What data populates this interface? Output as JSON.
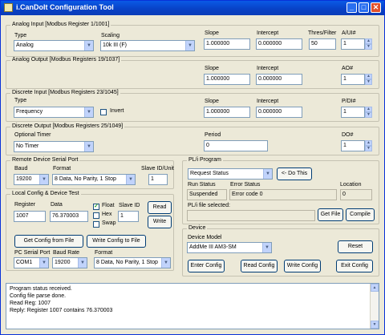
{
  "window": {
    "title": "i.CanDoIt Configuration Tool",
    "minimize": "_",
    "maximize": "□",
    "close": "✕"
  },
  "analog_input": {
    "legend": "Analog Input    [Modbus Register 1/1001]",
    "type_label": "Type",
    "type_value": "Analog",
    "scaling_label": "Scaling",
    "scaling_value": "10k III (F)",
    "slope_label": "Slope",
    "slope_value": "1.000000",
    "intercept_label": "Intercept",
    "intercept_value": "0.000000",
    "thres_label": "Thres/Filter",
    "thres_value": "50",
    "ui_label": "A/UI#",
    "ui_value": "1"
  },
  "analog_output": {
    "legend": "Analog Output    [Modbus Registers 19/1037]",
    "slope_label": "Slope",
    "slope_value": "1.000000",
    "intercept_label": "Intercept",
    "intercept_value": "0.000000",
    "ao_label": "AO#",
    "ao_value": "1"
  },
  "discrete_input": {
    "legend": "Discrete Input    [Modbus Registers 23/1045]",
    "type_label": "Type",
    "type_value": "Frequency",
    "invert_label": "Invert",
    "slope_label": "Slope",
    "slope_value": "1.000000",
    "intercept_label": "Intercept",
    "intercept_value": "0.000000",
    "di_label": "P/DI#",
    "di_value": "1"
  },
  "discrete_output": {
    "legend": "Discrete Output    [Modbus Registers 25/1049]",
    "timer_label": "Optional Timer",
    "timer_value": "No Timer",
    "period_label": "Period",
    "period_value": "0",
    "do_label": "DO#",
    "do_value": "1"
  },
  "remote_port": {
    "legend": "Remote Device Serial Port",
    "baud_label": "Baud",
    "baud_value": "19200",
    "format_label": "Format",
    "format_value": "8 Data, No Parity, 1 Stop",
    "slave_label": "Slave ID/Unit",
    "slave_value": "1"
  },
  "local_config": {
    "legend": "Local Config & Device Test",
    "register_label": "Register",
    "register_value": "1007",
    "data_label": "Data",
    "data_value": "76.370003",
    "float_label": "Float",
    "float_checked": "✓",
    "hex_label": "Hex",
    "swap_label": "Swap",
    "slave_label": "Slave ID",
    "slave_value": "1",
    "read_button": "Read",
    "write_button": "Write",
    "get_config_button": "Get Config from File",
    "write_config_button": "Write Config to File",
    "pc_port_label": "PC Serial Port",
    "pc_port_value": "COM1",
    "baud_label": "Baud Rate",
    "baud_value": "19200",
    "format_label": "Format",
    "format_value": "8 Data, No Parity, 1 Stop"
  },
  "plc_program": {
    "legend": "PL/i Program",
    "request_value": "Request Status",
    "do_this_button": "<- Do This",
    "run_status_label": "Run Status",
    "run_status_value": "Suspended",
    "error_status_label": "Error Status",
    "error_status_value": "Error code 0",
    "location_label": "Location",
    "location_value": "0",
    "file_label": "PL/i file selected:",
    "file_value": "",
    "get_file_button": "Get File",
    "compile_button": "Compile"
  },
  "device": {
    "legend": "Device",
    "model_label": "Device Model",
    "model_value": "AddMe III AM3-SM",
    "reset_button": "Reset",
    "enter_config_button": "Enter Config",
    "read_config_button": "Read Config",
    "write_config_button": "Write Config",
    "exit_config_button": "Exit Config"
  },
  "log": {
    "lines": [
      "Program status received.",
      "Config file parse done.",
      "Read Reg: 1007",
      "Reply: Register 1007 contains 76.370003"
    ]
  },
  "colors": {
    "title_bar": "#0842c7",
    "background": "#ece9d8",
    "field_border": "#7f9db9"
  }
}
